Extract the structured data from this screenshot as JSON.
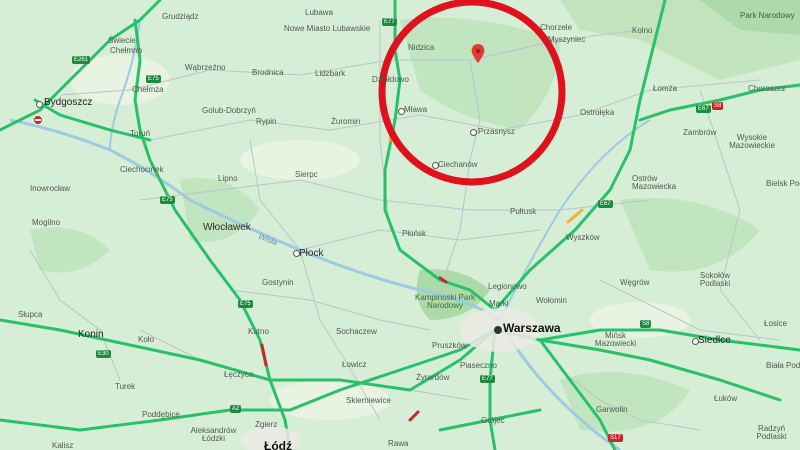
{
  "map": {
    "places": [
      {
        "id": "grudziadz",
        "name": "Grudziądz"
      },
      {
        "id": "lubawa",
        "name": "Lubawa"
      },
      {
        "id": "nowe-miasto",
        "name": "Nowe Miasto Lubawskie"
      },
      {
        "id": "nidzica",
        "name": "Nidzica"
      },
      {
        "id": "chorzele",
        "name": "Chorzele"
      },
      {
        "id": "myszyniec",
        "name": "Myszyniec"
      },
      {
        "id": "kolno",
        "name": "Kolno"
      },
      {
        "id": "park-narodowy",
        "name": "Park Narodowy"
      },
      {
        "id": "swiecie",
        "name": "Świecie"
      },
      {
        "id": "chelmno",
        "name": "Chełmno"
      },
      {
        "id": "wabrzezno",
        "name": "Wąbrzeźno"
      },
      {
        "id": "brodnica",
        "name": "Brodnica"
      },
      {
        "id": "lidzbark",
        "name": "Lidzbark"
      },
      {
        "id": "dzialdowo",
        "name": "Działdowo"
      },
      {
        "id": "lomza",
        "name": "Łomża"
      },
      {
        "id": "chorzele2",
        "name": "Choroszcz"
      },
      {
        "id": "bydgoszcz",
        "name": "Bydgoszcz"
      },
      {
        "id": "chelmza",
        "name": "Chełmża"
      },
      {
        "id": "golub",
        "name": "Golub-Dobrzyń"
      },
      {
        "id": "mlawa",
        "name": "Mława"
      },
      {
        "id": "zuromin",
        "name": "Żuromin"
      },
      {
        "id": "ostroleka",
        "name": "Ostrołęka"
      },
      {
        "id": "torun",
        "name": "Toruń"
      },
      {
        "id": "rypin",
        "name": "Rypin"
      },
      {
        "id": "przasnysz",
        "name": "Przasnysz"
      },
      {
        "id": "zambrow",
        "name": "Zambrów"
      },
      {
        "id": "wysokie",
        "name": "Wysokie Mazowieckie"
      },
      {
        "id": "ciechocinek",
        "name": "Ciechocinek"
      },
      {
        "id": "ciechanow",
        "name": "Ciechanów"
      },
      {
        "id": "lipno",
        "name": "Lipno"
      },
      {
        "id": "sierpc",
        "name": "Sierpc"
      },
      {
        "id": "ostrow",
        "name": "Ostrów Mazowiecka"
      },
      {
        "id": "bielsk",
        "name": "Bielsk Pod"
      },
      {
        "id": "inowroclaw",
        "name": "Inowrocław"
      },
      {
        "id": "pultusk",
        "name": "Pułtusk"
      },
      {
        "id": "wloclawek",
        "name": "Włocławek"
      },
      {
        "id": "mogilno",
        "name": "Mogilno"
      },
      {
        "id": "plonsk",
        "name": "Płońsk"
      },
      {
        "id": "wyszkow",
        "name": "Wyszków"
      },
      {
        "id": "plock",
        "name": "Płock"
      },
      {
        "id": "sokolow",
        "name": "Sokołów Podlaski"
      },
      {
        "id": "gostynin",
        "name": "Gostynin"
      },
      {
        "id": "legionowo",
        "name": "Legionowo"
      },
      {
        "id": "wegrow",
        "name": "Węgrów"
      },
      {
        "id": "kampinoski",
        "name": "Kampinoski Park Narodowy"
      },
      {
        "id": "marki",
        "name": "Marki"
      },
      {
        "id": "wolomin",
        "name": "Wołomin"
      },
      {
        "id": "slupca",
        "name": "Słupca"
      },
      {
        "id": "warszawa",
        "name": "Warszawa"
      },
      {
        "id": "konin",
        "name": "Konin"
      },
      {
        "id": "kutno",
        "name": "Kutno"
      },
      {
        "id": "sochaczew",
        "name": "Sochaczew"
      },
      {
        "id": "minsk",
        "name": "Mińsk Mazowiecki"
      },
      {
        "id": "siedlce",
        "name": "Siedlce"
      },
      {
        "id": "losice",
        "name": "Łosice"
      },
      {
        "id": "kolo",
        "name": "Koło"
      },
      {
        "id": "lowicz",
        "name": "Łowicz"
      },
      {
        "id": "pruszkow",
        "name": "Pruszków"
      },
      {
        "id": "leczyca",
        "name": "Łęczyca"
      },
      {
        "id": "piaseczno",
        "name": "Piaseczno"
      },
      {
        "id": "zyrardow",
        "name": "Żyrardów"
      },
      {
        "id": "biala",
        "name": "Biała Pod"
      },
      {
        "id": "turek",
        "name": "Turek"
      },
      {
        "id": "skierniewice",
        "name": "Skierniewice"
      },
      {
        "id": "garwolin",
        "name": "Garwolin"
      },
      {
        "id": "lukow",
        "name": "Łuków"
      },
      {
        "id": "poddebice",
        "name": "Poddębice"
      },
      {
        "id": "zgierz",
        "name": "Zgierz"
      },
      {
        "id": "aleksandrow",
        "name": "Aleksandrów Łódzki"
      },
      {
        "id": "kalisz",
        "name": "Kalisz"
      },
      {
        "id": "lodz",
        "name": "Łódź"
      },
      {
        "id": "rawa",
        "name": "Rawa"
      },
      {
        "id": "grojec",
        "name": "Grójec"
      },
      {
        "id": "radzyn",
        "name": "Radzyń Podlaski"
      }
    ],
    "river_label": "Wisła",
    "road_shields": [
      "E261",
      "E75",
      "E75",
      "E75",
      "E77",
      "E67",
      "E30",
      "A2",
      "E67",
      "S8",
      "S17",
      "E77",
      "S8"
    ],
    "marker_color": "#e53935",
    "circle_color": "#e0101c"
  }
}
